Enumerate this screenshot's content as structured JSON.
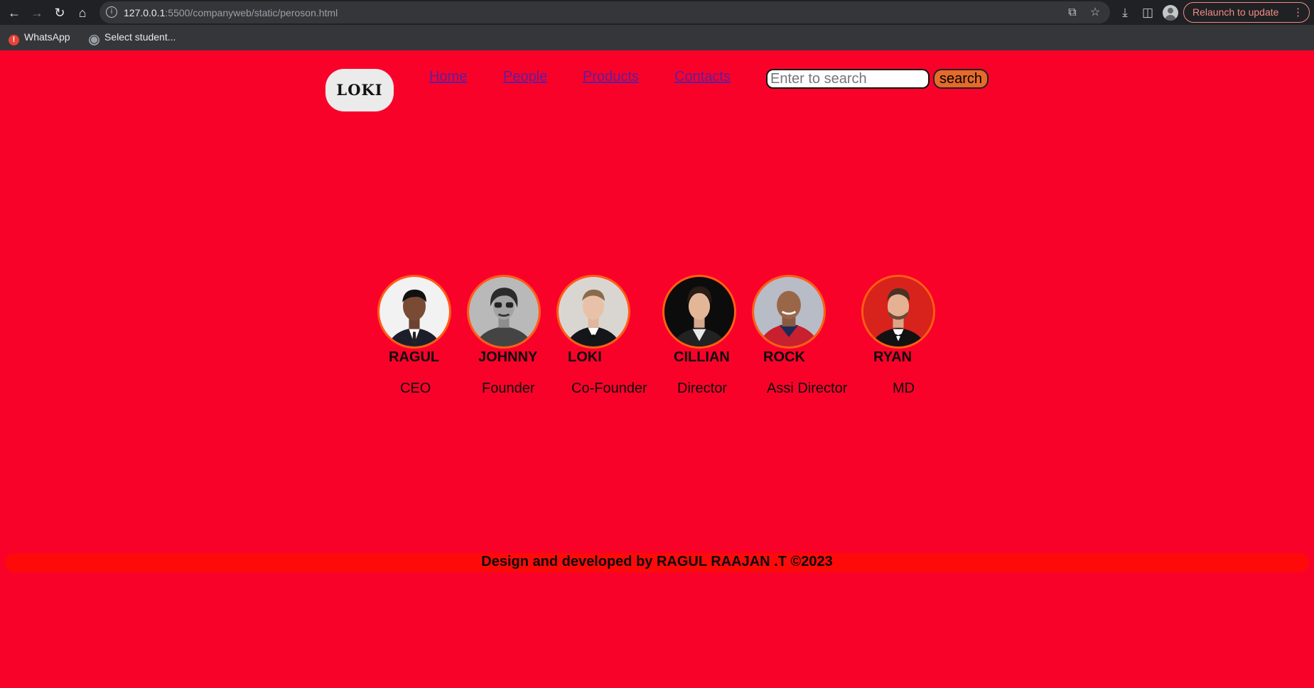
{
  "browser": {
    "url_host": "127.0.0.1",
    "url_rest": ":5500/companyweb/static/peroson.html",
    "relaunch_label": "Relaunch to update",
    "bookmarks": [
      "WhatsApp",
      "Select student..."
    ],
    "icons": [
      "back-icon",
      "forward-icon",
      "reload-icon",
      "home-icon",
      "info-icon",
      "share-icon",
      "star-icon",
      "download-icon",
      "sidepanel-icon",
      "profile-icon",
      "menu-dots-icon"
    ]
  },
  "header": {
    "logo_text": "LOKI",
    "nav": [
      "Home",
      "People",
      "Products",
      "Contacts"
    ],
    "search_placeholder": "Enter to search",
    "search_button": "search"
  },
  "people": [
    {
      "name": "RAGUL",
      "role": "CEO"
    },
    {
      "name": "JOHNNY",
      "role": "Founder"
    },
    {
      "name": "LOKI",
      "role": "Co-Founder"
    },
    {
      "name": "CILLIAN",
      "role": "Director"
    },
    {
      "name": "ROCK",
      "role": "Assi Director"
    },
    {
      "name": "RYAN",
      "role": "MD"
    }
  ],
  "footer": {
    "text": "Design and developed by RAGUL RAAJAN .T ©2023"
  },
  "colors": {
    "page_background": "#f9022a",
    "search_button": "#e46b2a",
    "photo_border": "#ff5d12",
    "footer_bar": "#fe0a0a",
    "link": "#5b1fa0"
  }
}
